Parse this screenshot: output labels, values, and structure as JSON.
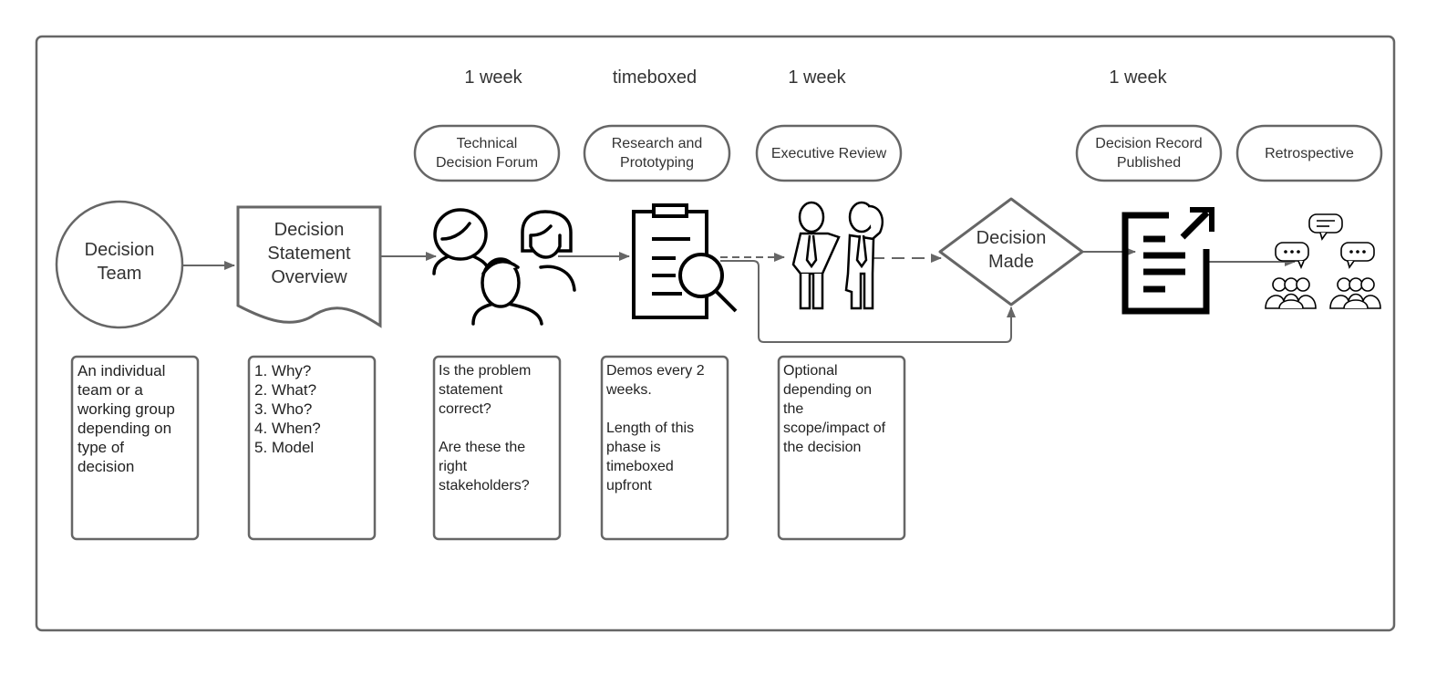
{
  "durations": {
    "tdf": "1 week",
    "research": "timeboxed",
    "exec": "1 week",
    "record": "1 week"
  },
  "phases": {
    "tdf": [
      "Technical",
      "Decision Forum"
    ],
    "research": [
      "Research and",
      "Prototyping"
    ],
    "exec": [
      "Executive Review"
    ],
    "record": [
      "Decision Record",
      "Published"
    ],
    "retro": [
      "Retrospective"
    ]
  },
  "nodes": {
    "team": [
      "Decision",
      "Team"
    ],
    "statement": [
      "Decision",
      "Statement",
      "Overview"
    ],
    "decision": [
      "Decision",
      "Made"
    ]
  },
  "notes": {
    "team": [
      "An individual",
      "team or a",
      "working group",
      "depending on",
      "type of",
      "decision"
    ],
    "statement": [
      "1. Why?",
      "2. What?",
      "3. Who?",
      "4. When?",
      "5. Model"
    ],
    "tdf": [
      "Is the problem",
      "statement",
      "correct?",
      "",
      "Are these the",
      "right",
      "stakeholders?"
    ],
    "research": [
      "Demos every 2",
      "weeks.",
      "",
      "Length of this",
      "phase is",
      "timeboxed",
      "upfront"
    ],
    "exec": [
      "Optional",
      "depending on",
      "the",
      "scope/impact of",
      "the decision"
    ]
  },
  "colors": {
    "stroke": "#666666",
    "icon": "#000000",
    "text": "#333333"
  }
}
